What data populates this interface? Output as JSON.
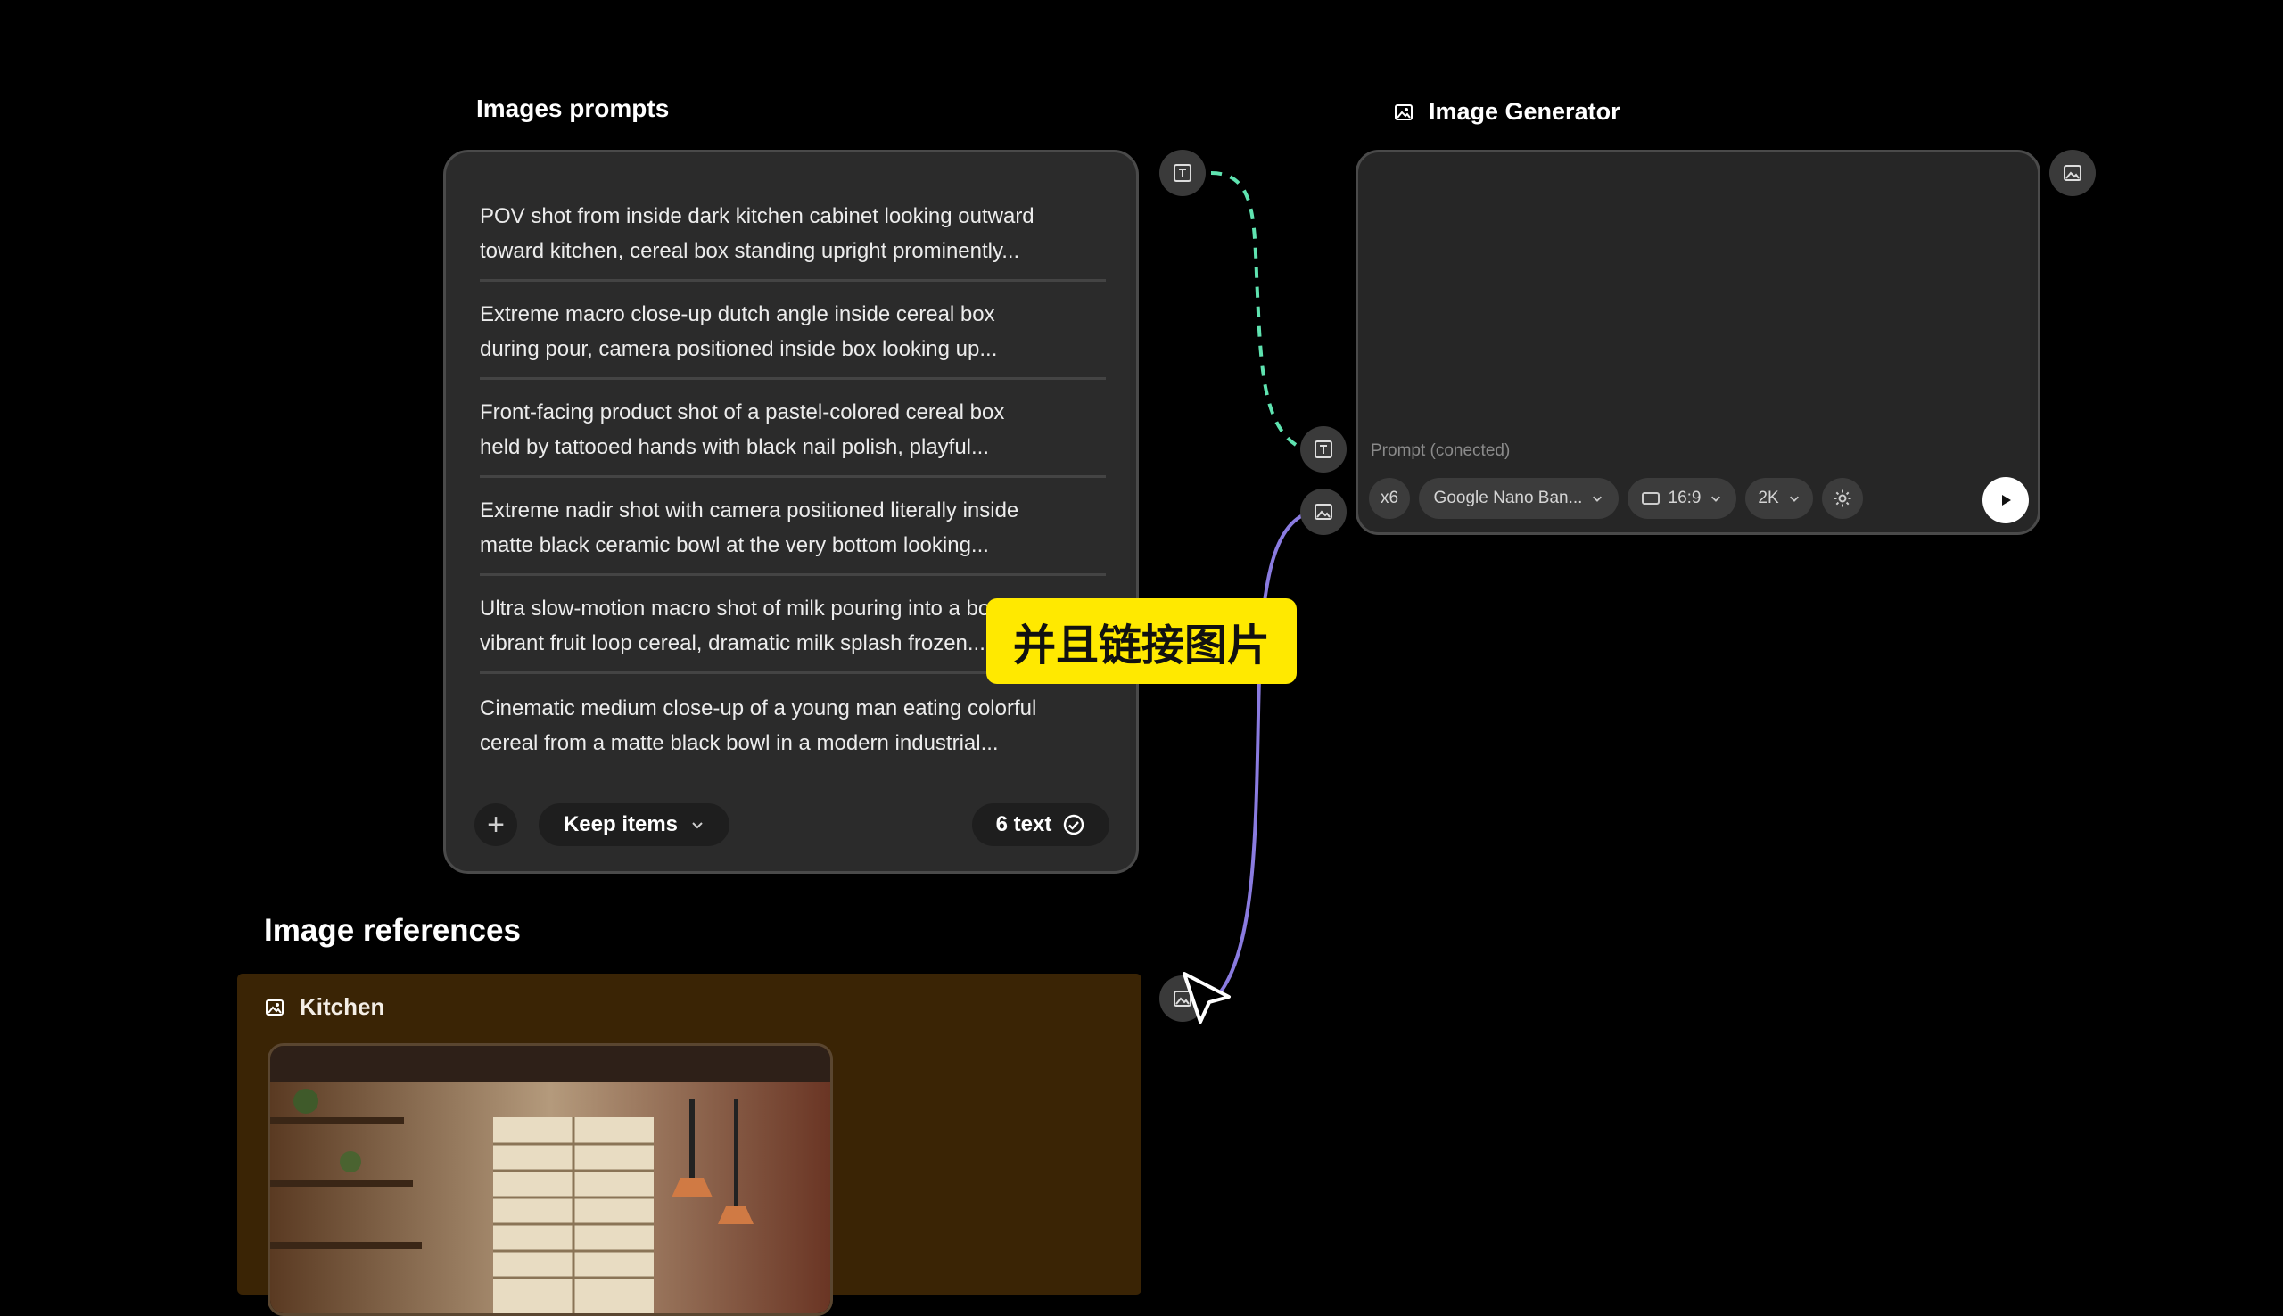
{
  "prompts_node": {
    "title": "Images prompts",
    "items": [
      {
        "line1": "POV shot from inside dark kitchen cabinet looking outward",
        "line2": "toward kitchen, cereal box standing upright prominently..."
      },
      {
        "line1": "Extreme macro close-up dutch angle inside cereal box",
        "line2": "during pour, camera positioned inside box looking up..."
      },
      {
        "line1": "Front-facing product shot of a pastel-colored cereal box",
        "line2": "held by tattooed hands with black nail polish, playful..."
      },
      {
        "line1": "Extreme nadir shot with camera positioned literally inside",
        "line2": "matte black ceramic bowl at the very bottom looking..."
      },
      {
        "line1": "Ultra slow-motion macro shot of milk pouring into a bowl of",
        "line2": "vibrant fruit loop cereal, dramatic milk splash frozen..."
      },
      {
        "line1": "Cinematic medium close-up of a young man eating colorful",
        "line2": "cereal from a matte black bowl in a modern industrial..."
      }
    ],
    "add_label": "+",
    "keep_items_label": "Keep items",
    "count_label": "6 text"
  },
  "generator_node": {
    "title": "Image Generator",
    "prompt_status": "Prompt (conected)",
    "count": "x6",
    "model": "Google Nano Ban...",
    "aspect_ratio": "16:9",
    "resolution": "2K"
  },
  "references": {
    "title": "Image references",
    "kitchen_label": "Kitchen"
  },
  "subtitle": "并且链接图片",
  "colors": {
    "text_edge": "#5fe3b0",
    "image_edge": "#8a7be0",
    "subtitle_bg": "#ffe900",
    "reference_bg": "#3a2405"
  }
}
